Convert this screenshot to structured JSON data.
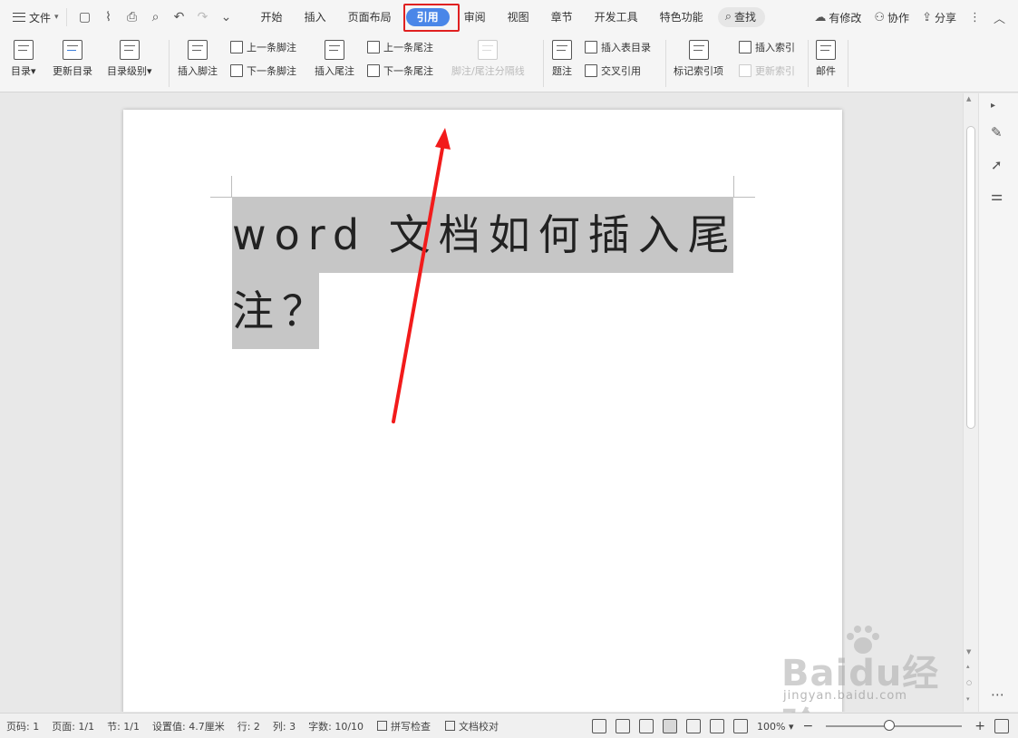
{
  "menubar": {
    "file_label": "文件",
    "tabs": [
      {
        "label": "开始"
      },
      {
        "label": "插入"
      },
      {
        "label": "页面布局"
      },
      {
        "label": "引用",
        "active": true
      },
      {
        "label": "审阅"
      },
      {
        "label": "视图"
      },
      {
        "label": "章节"
      },
      {
        "label": "开发工具"
      },
      {
        "label": "特色功能"
      }
    ],
    "search_label": "查找",
    "right": {
      "modified": "有修改",
      "collab": "协作",
      "share": "分享"
    }
  },
  "ribbon": {
    "toc": "目录",
    "update_toc": "更新目录",
    "toc_level": "目录级别",
    "insert_footnote": "插入脚注",
    "prev_footnote": "上一条脚注",
    "next_footnote": "下一条脚注",
    "insert_endnote": "插入尾注",
    "prev_endnote": "上一条尾注",
    "next_endnote": "下一条尾注",
    "note_separator": "脚注/尾注分隔线",
    "caption": "题注",
    "insert_table_of_figures": "插入表目录",
    "cross_reference": "交叉引用",
    "mark_index_entry": "标记索引项",
    "insert_index": "插入索引",
    "update_index": "更新索引",
    "mail": "邮件"
  },
  "document": {
    "line1": "word 文档如何插入尾",
    "line2": "注？"
  },
  "watermark": {
    "main": "Baidu经验",
    "sub": "jingyan.baidu.com"
  },
  "statusbar": {
    "page_num": "页码: 1",
    "pages": "页面: 1/1",
    "section": "节: 1/1",
    "setting": "设置值: 4.7厘米",
    "row": "行: 2",
    "col": "列: 3",
    "word_count": "字数: 10/10",
    "spellcheck": "拼写检查",
    "proofread": "文档校对",
    "zoom": "100%"
  },
  "colors": {
    "active_tab": "#4a86e8",
    "highlight_box": "#e02020",
    "annotation_arrow": "#f21b1b",
    "selection": "#c6c6c6"
  }
}
